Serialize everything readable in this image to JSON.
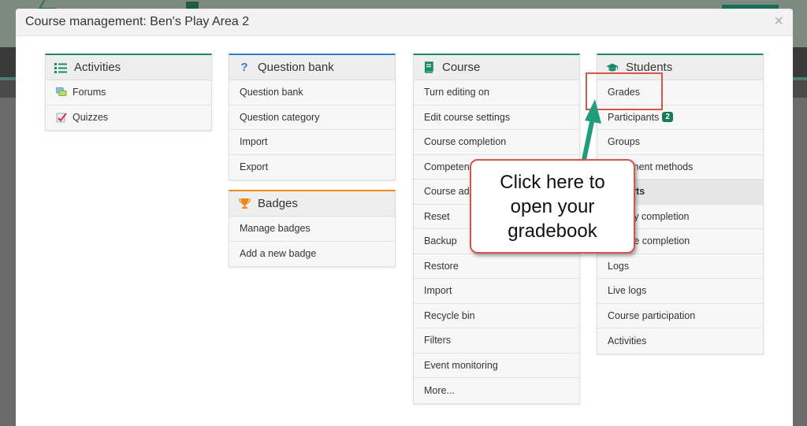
{
  "modal": {
    "title": "Course management: Ben's Play Area 2",
    "close_label": "×"
  },
  "activities": {
    "title": "Activities",
    "items": [
      {
        "label": "Forums",
        "icon": "forum-icon"
      },
      {
        "label": "Quizzes",
        "icon": "quiz-icon"
      }
    ]
  },
  "question_bank": {
    "title": "Question bank",
    "items": [
      {
        "label": "Question bank"
      },
      {
        "label": "Question category"
      },
      {
        "label": "Import"
      },
      {
        "label": "Export"
      }
    ]
  },
  "badges": {
    "title": "Badges",
    "items": [
      {
        "label": "Manage badges"
      },
      {
        "label": "Add a new badge"
      }
    ]
  },
  "course": {
    "title": "Course",
    "items": [
      {
        "label": "Turn editing on"
      },
      {
        "label": "Edit course settings"
      },
      {
        "label": "Course completion"
      },
      {
        "label": "Competencies"
      },
      {
        "label": "Course administration"
      },
      {
        "label": "Reset"
      },
      {
        "label": "Backup"
      },
      {
        "label": "Restore"
      },
      {
        "label": "Import"
      },
      {
        "label": "Recycle bin"
      },
      {
        "label": "Filters"
      },
      {
        "label": "Event monitoring"
      },
      {
        "label": "More..."
      }
    ]
  },
  "students": {
    "title": "Students",
    "participants_badge": "2",
    "items": [
      {
        "label": "Grades"
      },
      {
        "label": "Participants"
      },
      {
        "label": "Groups"
      },
      {
        "label": "Enrolment methods"
      },
      {
        "label": "Reports"
      },
      {
        "label": "Activity completion"
      },
      {
        "label": "Course completion"
      },
      {
        "label": "Logs"
      },
      {
        "label": "Live logs"
      },
      {
        "label": "Course participation"
      },
      {
        "label": "Activities"
      }
    ]
  },
  "callout": {
    "text": "Click here to open your gradebook"
  },
  "colors": {
    "accent_green": "#1b8a68",
    "accent_blue": "#2c7fd0",
    "accent_orange": "#f0891d",
    "annotation_red": "#d9534f",
    "arrow_teal": "#1e9e7a"
  }
}
